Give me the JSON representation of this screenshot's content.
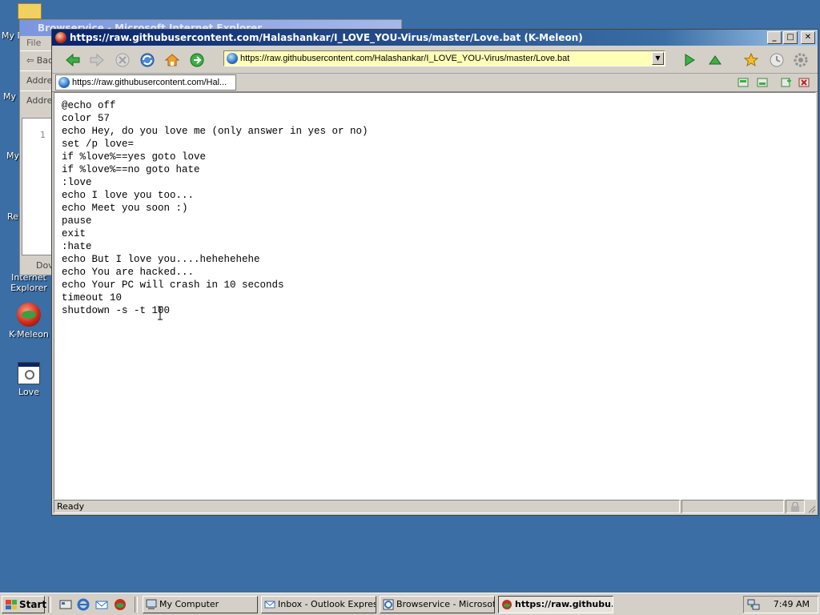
{
  "desktop": {
    "icons": [
      {
        "label": "Internet Explorer"
      },
      {
        "label": "K-Meleon"
      },
      {
        "label": "Love"
      }
    ],
    "clipped_labels": [
      "My D",
      "My",
      "My",
      "Re"
    ]
  },
  "bg_window": {
    "title": "Browservice - Microsoft Internet Explorer",
    "menu_file": "File",
    "back": "Bac",
    "address1": "Addres",
    "address2": "Addre",
    "line_no": "1",
    "status": "Dov"
  },
  "window": {
    "title": "https://raw.githubusercontent.com/Halashankar/I_LOVE_YOU-Virus/master/Love.bat (K-Meleon)",
    "minimize": "_",
    "maximize": "□",
    "close": "✕"
  },
  "toolbar": {
    "url": "https://raw.githubusercontent.com/Halashankar/I_LOVE_YOU-Virus/master/Love.bat"
  },
  "tab": {
    "label": "https://raw.githubusercontent.com/Hal..."
  },
  "content": {
    "lines": [
      "@echo off",
      "color 57",
      "echo Hey, do you love me (only answer in yes or no)",
      "set /p love=",
      "if %love%==yes goto love",
      "if %love%==no goto hate",
      ":love",
      "echo I love you too...",
      "echo Meet you soon :)",
      "pause",
      "exit",
      ":hate",
      "echo But I love you....hehehehehe",
      "echo You are hacked...",
      "echo Your PC will crash in 10 seconds",
      "timeout 10",
      "shutdown -s -t 100"
    ]
  },
  "statusbar": {
    "text": "Ready"
  },
  "taskbar": {
    "start": "Start",
    "tasks": [
      {
        "label": "My Computer"
      },
      {
        "label": "Inbox - Outlook Express"
      },
      {
        "label": "Browservice - Microsof..."
      },
      {
        "label": "https://raw.githubu..."
      }
    ],
    "clock": "7:49 AM"
  },
  "colors": {
    "desktop": "#3a6ea5",
    "titlebar": "#0a246a",
    "url_bg": "#ffffb8",
    "toolbar_green": "#3cb043"
  }
}
